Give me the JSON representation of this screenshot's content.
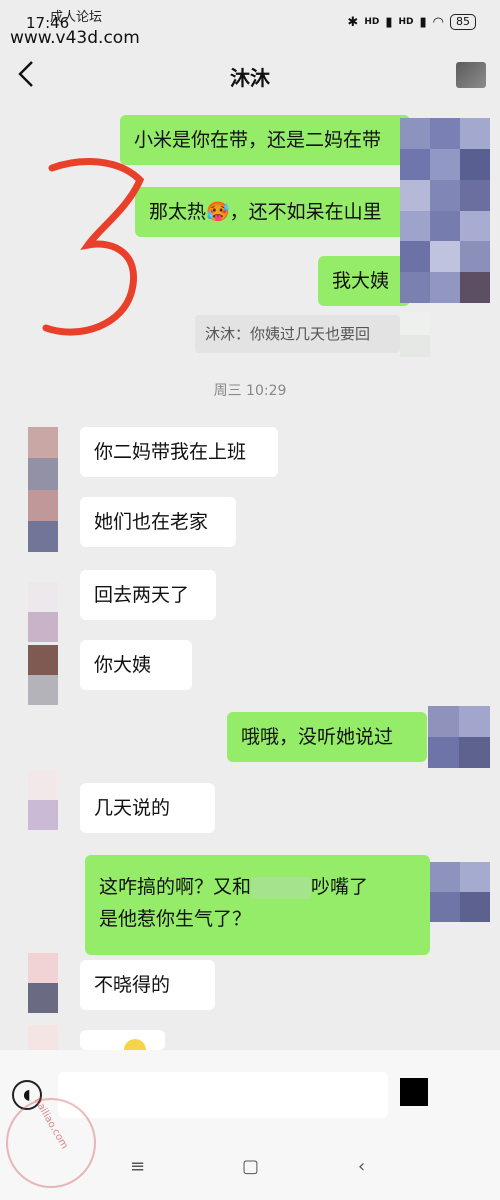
{
  "status": {
    "time": "17:46",
    "watermark_top": "成人论坛",
    "watermark_url": "www.v43d.com",
    "network": "HD",
    "battery": "85"
  },
  "header": {
    "title": "沐沐"
  },
  "messages": [
    {
      "side": "out",
      "text": "小米是你在带，还是二妈在带"
    },
    {
      "side": "out",
      "text": "那太热🥵，还不如呆在山里"
    },
    {
      "side": "out",
      "text": "我大姨"
    },
    {
      "type": "quote",
      "text": "沐沐：你姨过几天也要回"
    },
    {
      "type": "time",
      "text": "周三 10:29"
    },
    {
      "side": "in",
      "text": "你二妈带我在上班"
    },
    {
      "side": "in",
      "text": "她们也在老家"
    },
    {
      "side": "in",
      "text": "回去两天了"
    },
    {
      "side": "in",
      "text": "你大姨"
    },
    {
      "side": "out",
      "text": "哦哦，没听她说过"
    },
    {
      "side": "in",
      "text": "几天说的"
    },
    {
      "side": "out",
      "line1": "这咋搞的啊？又和",
      "line1b": "吵嘴了",
      "line2": "是他惹你生气了？"
    },
    {
      "side": "in",
      "text": "不晓得的"
    }
  ],
  "nav": {
    "menu": "≡",
    "home": "▢",
    "back": "‹"
  },
  "stamp": "hailiao.com",
  "colors": {
    "outgoing_bubble": "#95ec69",
    "incoming_bubble": "#ffffff",
    "background": "#ededed",
    "annotation": "#e8402a"
  }
}
